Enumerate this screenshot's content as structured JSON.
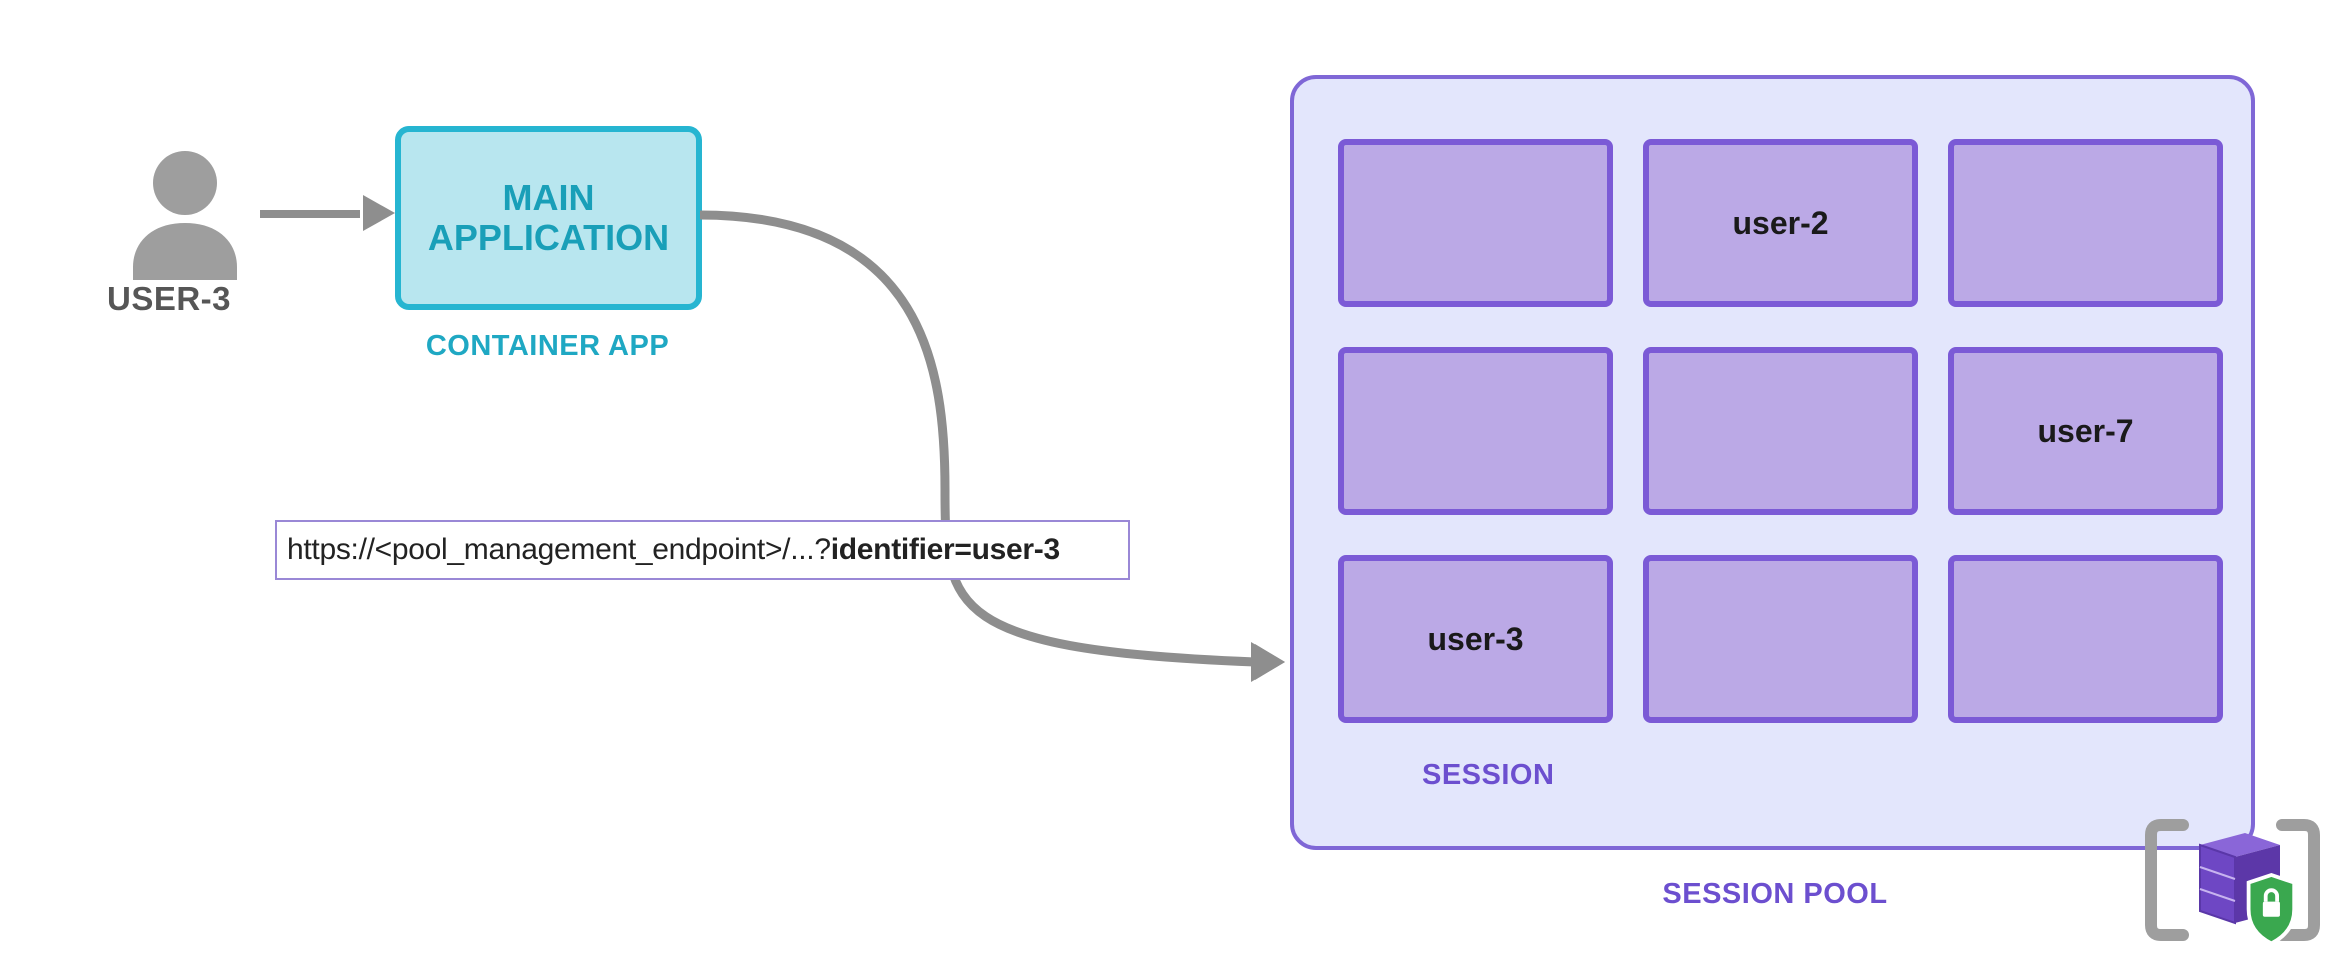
{
  "user": {
    "label": "USER-3"
  },
  "container_app": {
    "title_line1": "MAIN",
    "title_line2": "APPLICATION",
    "caption": "CONTAINER APP"
  },
  "api_call": {
    "prefix": "https://<pool_management_endpoint>/...?",
    "query": "identifier=user-3"
  },
  "session_pool": {
    "label": "SESSION POOL",
    "session_tag": "SESSION",
    "cells": [
      {
        "label": ""
      },
      {
        "label": "user-2"
      },
      {
        "label": ""
      },
      {
        "label": ""
      },
      {
        "label": ""
      },
      {
        "label": "user-7"
      },
      {
        "label": "user-3"
      },
      {
        "label": ""
      },
      {
        "label": ""
      }
    ]
  },
  "colors": {
    "accent_cyan": "#26b5d1",
    "accent_purple": "#7b5ad6",
    "pool_bg": "#e3e6fc",
    "cell_bg": "#bba9e6",
    "arrow_gray": "#8e8e8e"
  }
}
